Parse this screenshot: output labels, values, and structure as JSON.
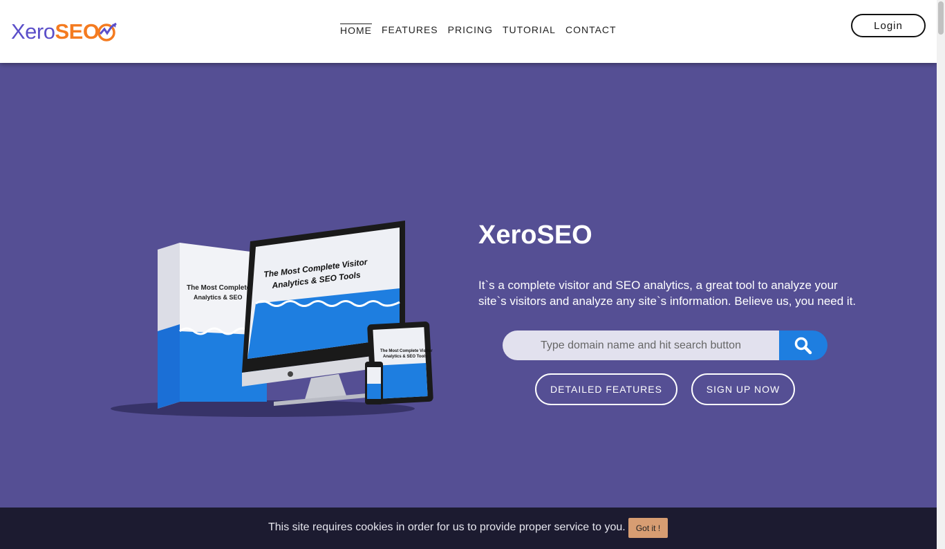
{
  "header": {
    "logo": {
      "part1": "Xero",
      "part2": "SEO"
    },
    "nav": [
      {
        "label": "HOME",
        "active": true
      },
      {
        "label": "FEATURES"
      },
      {
        "label": "PRICING"
      },
      {
        "label": "TUTORIAL"
      },
      {
        "label": "CONTACT"
      }
    ],
    "login_label": "Login"
  },
  "hero": {
    "product_box_text": "The Most Complete Visitor Analytics & SEO Tools",
    "title": "XeroSEO",
    "description": "It`s a complete visitor and SEO analytics, a great tool to analyze your site`s visitors and analyze any site`s information. Believe us, you need it.",
    "search": {
      "placeholder": "Type domain name and hit search button",
      "button_icon": "search-icon"
    },
    "buttons": {
      "features_label": "DETAILED FEATURES",
      "signup_label": "SIGN UP NOW"
    }
  },
  "cookie": {
    "message": "This site requires cookies in order for us to provide proper service to you.",
    "button_label": "Got it !"
  },
  "colors": {
    "hero_bg": "#554f94",
    "accent_blue": "#1e7ee0",
    "logo_purple": "#5b4fc9",
    "logo_orange": "#f47b20",
    "cookie_bg": "#1c1b30",
    "cookie_button": "#d79d72"
  }
}
